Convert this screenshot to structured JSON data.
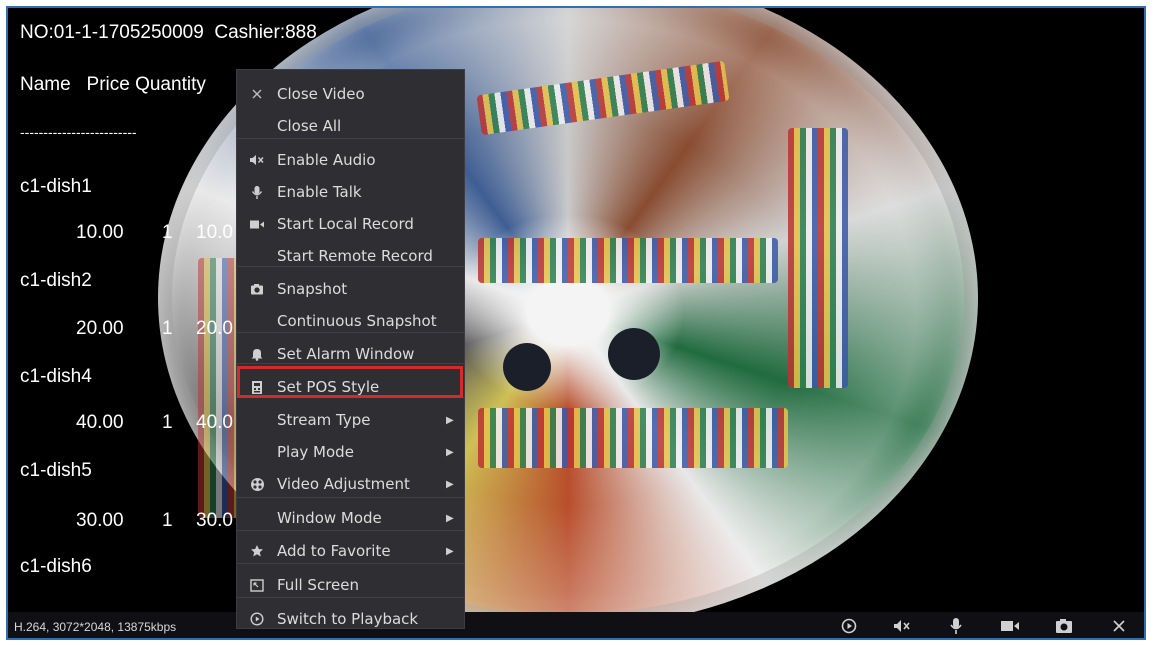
{
  "pos": {
    "header": "NO:01-1-1705250009  Cashier:888",
    "columns": "Name   Price Quantity",
    "divider": "-------------------------",
    "items": [
      {
        "name": "c1-dish1",
        "price": "10.00",
        "qty": "1",
        "amount": "10.0"
      },
      {
        "name": "c1-dish2",
        "price": "20.00",
        "qty": "1",
        "amount": "20.0"
      },
      {
        "name": "c1-dish4",
        "price": "40.00",
        "qty": "1",
        "amount": "40.0"
      },
      {
        "name": "c1-dish5",
        "price": "30.00",
        "qty": "1",
        "amount": "30.0"
      }
    ],
    "last_item": "c1-dish6"
  },
  "status": {
    "stream_info": "H.264, 3072*2048, 13875kbps"
  },
  "toolbar": {
    "icons": [
      "play-icon",
      "mute-icon",
      "microphone-icon",
      "record-camera-icon",
      "snapshot-icon",
      "close-icon"
    ]
  },
  "context_menu": {
    "items": [
      {
        "label": "Close Video",
        "icon": "close-icon"
      },
      {
        "label": "Close All",
        "icon": ""
      },
      {
        "label": "Enable Audio",
        "icon": "mute-icon"
      },
      {
        "label": "Enable Talk",
        "icon": "microphone-icon"
      },
      {
        "label": "Start Local Record",
        "icon": "record-camera-icon"
      },
      {
        "label": "Start Remote Record",
        "icon": ""
      },
      {
        "label": "Snapshot",
        "icon": "camera-icon"
      },
      {
        "label": "Continuous Snapshot",
        "icon": ""
      },
      {
        "label": "Set Alarm Window",
        "icon": "bell-icon"
      },
      {
        "label": "Set POS Style",
        "icon": "pos-icon",
        "highlighted": true
      },
      {
        "label": "Stream Type",
        "icon": "",
        "submenu": true
      },
      {
        "label": "Play Mode",
        "icon": "",
        "submenu": true
      },
      {
        "label": "Video Adjustment",
        "icon": "adjust-icon",
        "submenu": true
      },
      {
        "label": "Window Mode",
        "icon": "",
        "submenu": true
      },
      {
        "label": "Add to Favorite",
        "icon": "star-icon",
        "submenu": true
      },
      {
        "label": "Full Screen",
        "icon": "fullscreen-icon"
      },
      {
        "label": "Switch to Playback",
        "icon": "playback-icon"
      }
    ]
  },
  "colors": {
    "highlight_border": "#d32b2b",
    "frame_border": "#2f6fb2",
    "menu_bg": "#2f2f33"
  }
}
